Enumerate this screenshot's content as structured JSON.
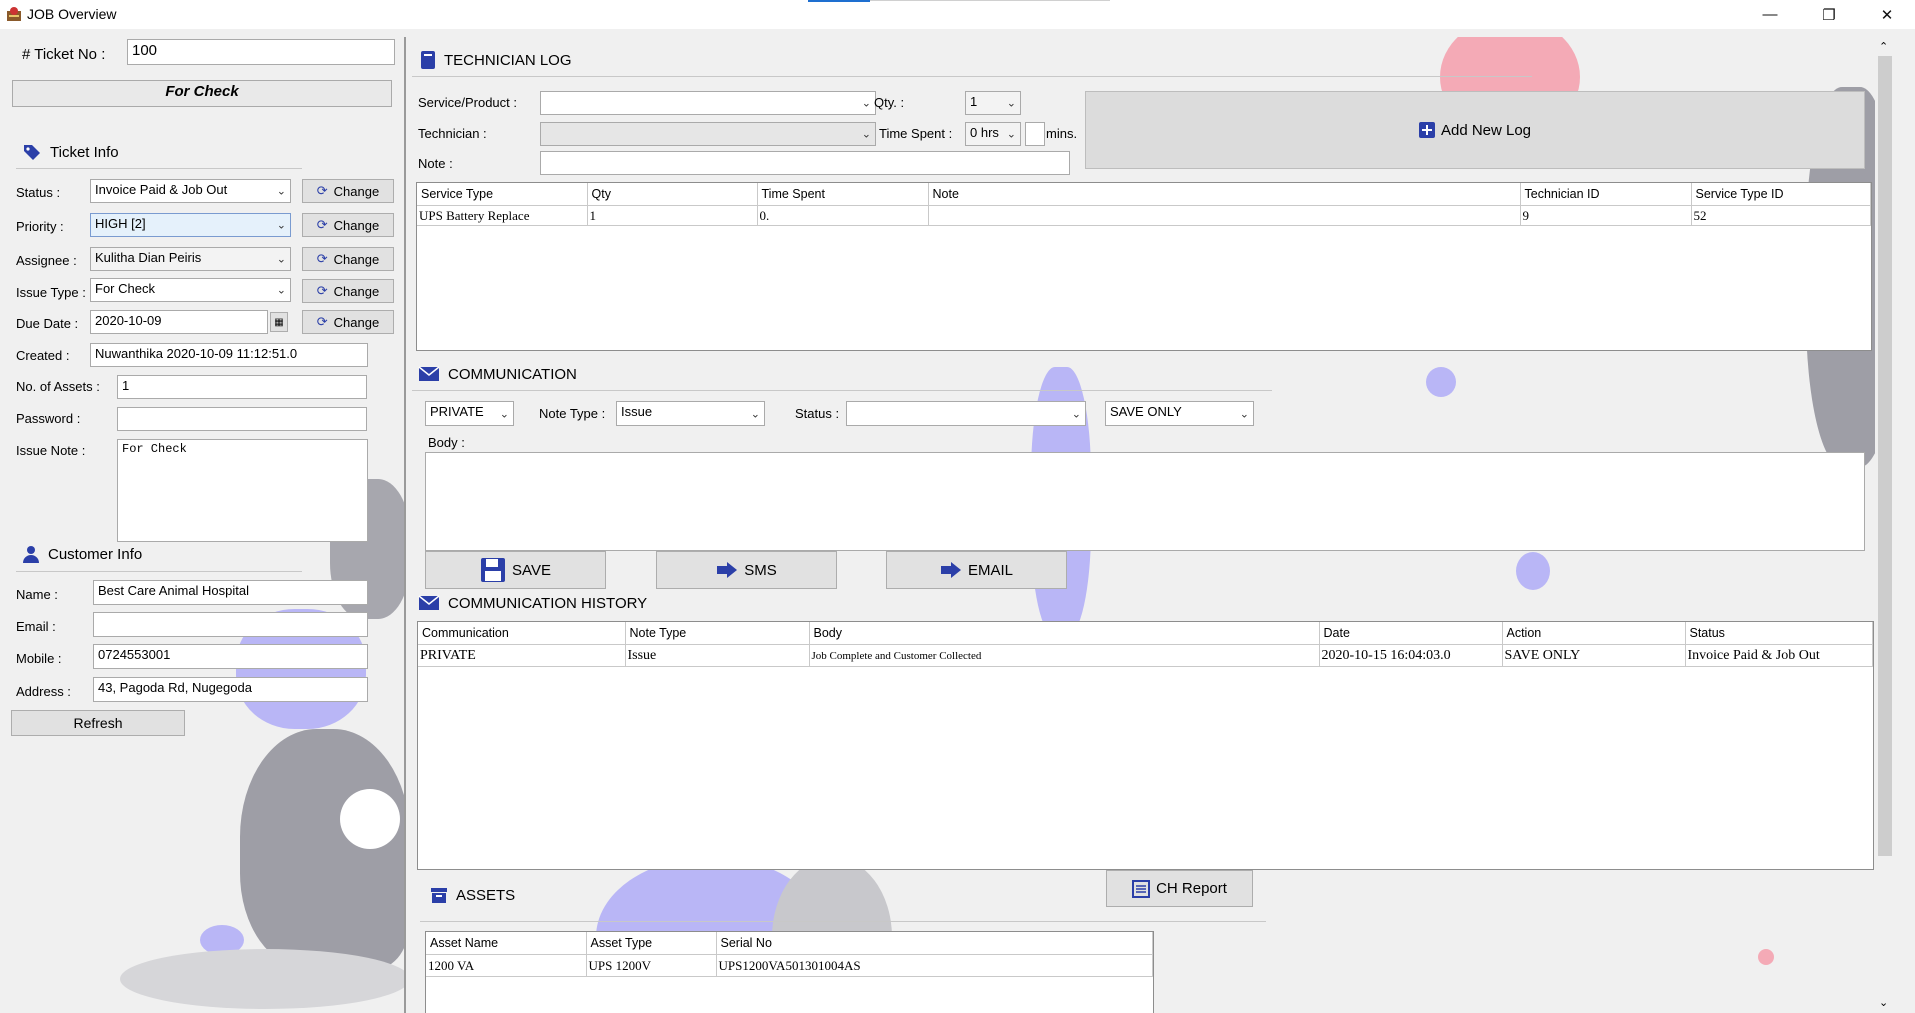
{
  "window": {
    "title": "JOB Overview",
    "minimize": "—",
    "maximize": "❐",
    "close": "✕"
  },
  "ticket": {
    "no_label": "# Ticket No :",
    "no_value": "100",
    "banner": "For Check"
  },
  "ticket_info": {
    "heading": "Ticket Info",
    "change_label": "Change",
    "status_label": "Status :",
    "status_value": "Invoice Paid & Job Out",
    "priority_label": "Priority :",
    "priority_value": "HIGH [2]",
    "assignee_label": "Assignee :",
    "assignee_value": "Kulitha Dian Peiris",
    "issue_type_label": "Issue Type :",
    "issue_type_value": "For Check",
    "due_date_label": "Due Date :",
    "due_date_value": "2020-10-09",
    "created_label": "Created :",
    "created_value": "Nuwanthika 2020-10-09 11:12:51.0",
    "assets_label": "No. of Assets :",
    "assets_value": "1",
    "password_label": "Password :",
    "password_value": "",
    "issue_note_label": "Issue Note :",
    "issue_note_value": "For Check"
  },
  "customer_info": {
    "heading": "Customer Info",
    "name_label": "Name :",
    "name_value": "Best Care Animal Hospital",
    "email_label": "Email :",
    "email_value": "",
    "mobile_label": "Mobile :",
    "mobile_value": "0724553001",
    "address_label": "Address :",
    "address_value": "43, Pagoda Rd, Nugegoda",
    "refresh_label": "Refresh"
  },
  "technician_log": {
    "heading": "TECHNICIAN LOG",
    "service_label": "Service/Product :",
    "service_value": "",
    "qty_label": "Qty. :",
    "qty_value": "1",
    "technician_label": "Technician :",
    "technician_value": "",
    "time_spent_label": "Time Spent :",
    "time_spent_hrs": "0 hrs",
    "mins_label": "mins.",
    "note_label": "Note :",
    "note_value": "",
    "add_log_label": "Add New Log",
    "columns": [
      "Service Type",
      "Qty",
      "Time Spent",
      "Note",
      "Technician ID",
      "Service Type ID"
    ],
    "rows": [
      [
        "UPS Battery Replace",
        "1",
        "0.",
        "",
        "9",
        "52"
      ]
    ]
  },
  "communication": {
    "heading": "COMMUNICATION",
    "visibility_value": "PRIVATE",
    "note_type_label": "Note Type :",
    "note_type_value": "Issue",
    "status_label": "Status :",
    "status_value": "",
    "mode_value": "SAVE ONLY",
    "body_label": "Body :",
    "save_label": "SAVE",
    "sms_label": "SMS",
    "email_label": "EMAIL"
  },
  "communication_history": {
    "heading": "COMMUNICATION HISTORY",
    "columns": [
      "Communication",
      "Note Type",
      "Body",
      "Date",
      "Action",
      "Status"
    ],
    "rows": [
      [
        "PRIVATE",
        "Issue",
        "Job Complete and Customer Collected",
        "2020-10-15 16:04:03.0",
        "SAVE ONLY",
        "Invoice Paid & Job Out"
      ]
    ],
    "report_label": "CH Report"
  },
  "assets": {
    "heading": "ASSETS",
    "columns": [
      "Asset Name",
      "Asset Type",
      "Serial No"
    ],
    "rows": [
      [
        "1200 VA",
        "UPS 1200V",
        "UPS1200VA501301004AS"
      ]
    ]
  },
  "colors": {
    "accent": "#2b3fa8",
    "banner_bg": "#e9e9e9",
    "decor_purple": "#b9b6f6",
    "decor_gray": "#9e9ea6",
    "decor_pink": "#f4aab6"
  }
}
